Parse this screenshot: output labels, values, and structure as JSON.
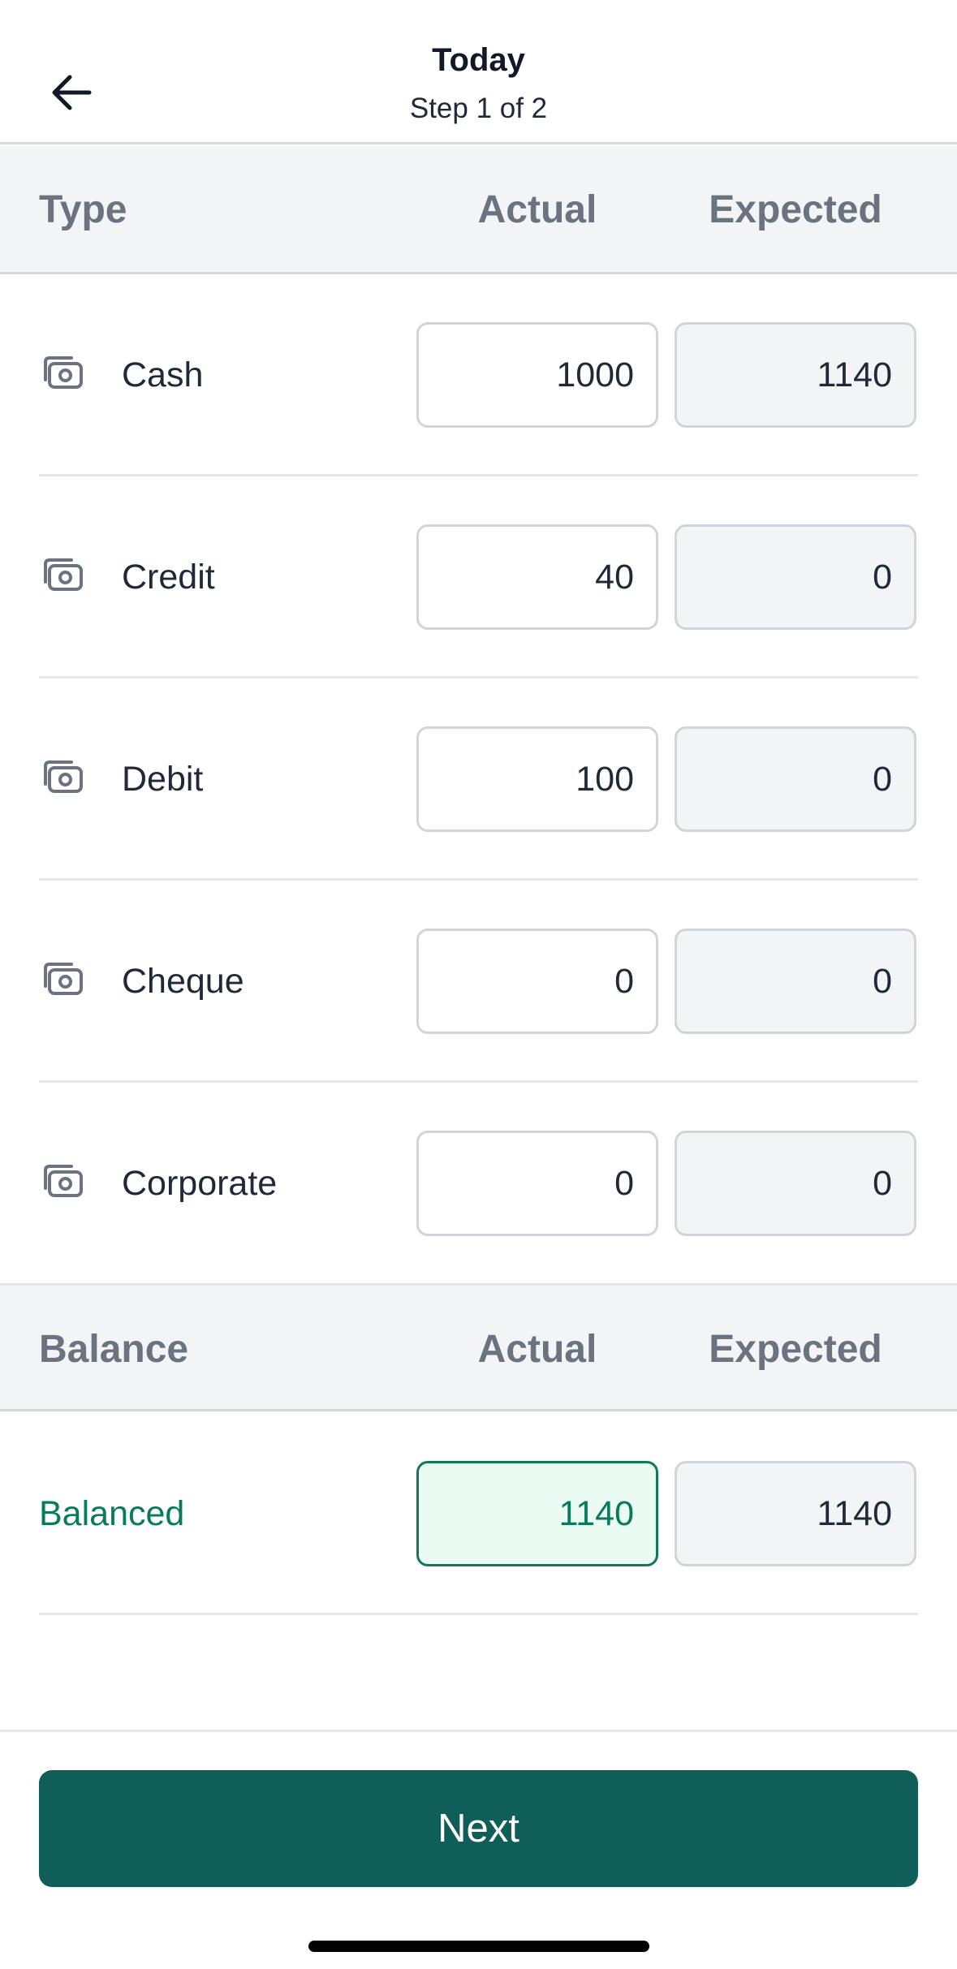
{
  "header": {
    "title": "Today",
    "subtitle": "Step 1 of 2",
    "back_icon": "arrow-left-icon"
  },
  "payments_table": {
    "columns": {
      "type": "Type",
      "actual": "Actual",
      "expected": "Expected"
    },
    "rows": [
      {
        "type": "Cash",
        "actual": "1000",
        "expected": "1140",
        "icon": "camera-icon"
      },
      {
        "type": "Credit",
        "actual": "40",
        "expected": "0",
        "icon": "camera-icon"
      },
      {
        "type": "Debit",
        "actual": "100",
        "expected": "0",
        "icon": "camera-icon"
      },
      {
        "type": "Cheque",
        "actual": "0",
        "expected": "0",
        "icon": "camera-icon"
      },
      {
        "type": "Corporate",
        "actual": "0",
        "expected": "0",
        "icon": "camera-icon"
      }
    ]
  },
  "balance_table": {
    "columns": {
      "balance": "Balance",
      "actual": "Actual",
      "expected": "Expected"
    },
    "status": "Balanced",
    "actual": "1140",
    "expected": "1140"
  },
  "footer": {
    "next_label": "Next"
  },
  "colors": {
    "primary": "#0f5e57",
    "success": "#0a7a5a",
    "success_bg": "#e9fbf2",
    "header_bg": "#f2f4f6"
  }
}
